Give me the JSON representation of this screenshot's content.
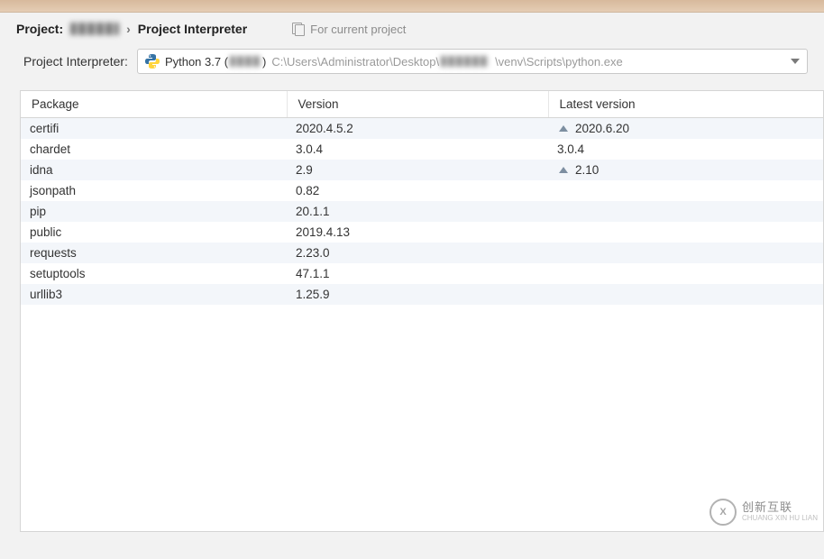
{
  "breadcrumb": {
    "project_label": "Project:",
    "separator": "›",
    "crumb": "Project Interpreter"
  },
  "for_project_label": "For current project",
  "interpreter_row": {
    "label": "Project Interpreter:",
    "selected_text_prefix": "Python 3.7 (",
    "selected_text_suffix": ")",
    "path_prefix": "C:\\Users\\Administrator\\Desktop\\",
    "path_suffix": "\\venv\\Scripts\\python.exe"
  },
  "table": {
    "headers": {
      "package": "Package",
      "version": "Version",
      "latest": "Latest version"
    },
    "rows": [
      {
        "package": "certifi",
        "version": "2020.4.5.2",
        "latest": "2020.6.20",
        "upgrade": true
      },
      {
        "package": "chardet",
        "version": "3.0.4",
        "latest": "3.0.4",
        "upgrade": false
      },
      {
        "package": "idna",
        "version": "2.9",
        "latest": "2.10",
        "upgrade": true
      },
      {
        "package": "jsonpath",
        "version": "0.82",
        "latest": "",
        "upgrade": false
      },
      {
        "package": "pip",
        "version": "20.1.1",
        "latest": "",
        "upgrade": false
      },
      {
        "package": "public",
        "version": "2019.4.13",
        "latest": "",
        "upgrade": false
      },
      {
        "package": "requests",
        "version": "2.23.0",
        "latest": "",
        "upgrade": false
      },
      {
        "package": "setuptools",
        "version": "47.1.1",
        "latest": "",
        "upgrade": false
      },
      {
        "package": "urllib3",
        "version": "1.25.9",
        "latest": "",
        "upgrade": false
      }
    ]
  },
  "watermark": {
    "line1": "创新互联",
    "line2": "CHUANG XIN HU LIAN"
  }
}
